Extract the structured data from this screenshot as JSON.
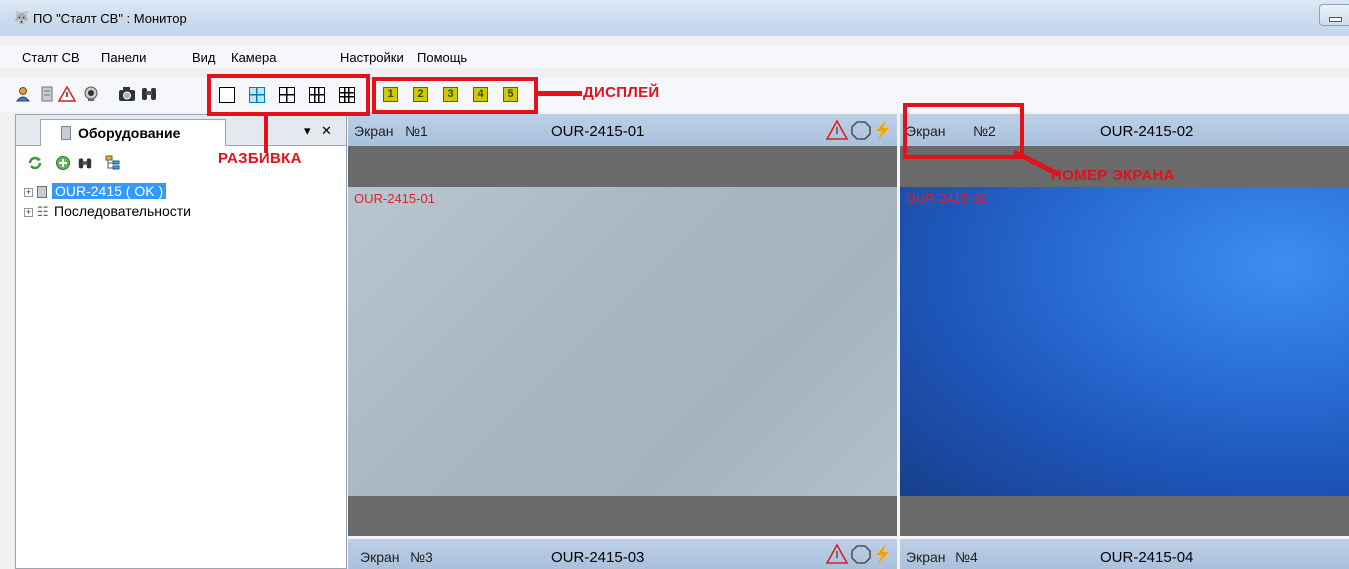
{
  "window": {
    "title": "ПО \"Сталт СВ\" : Монитор"
  },
  "menu": [
    "Сталт СВ",
    "Панели",
    "Вид",
    "Камера",
    "Настройки",
    "Помощь"
  ],
  "toolbar": {
    "display_buttons": [
      "1",
      "2",
      "3",
      "4",
      "5"
    ]
  },
  "annotations": {
    "display": "ДИСПЛЕЙ",
    "split": "РАЗБИВКА",
    "screen_number": "НОМЕР ЭКРАНА"
  },
  "panel": {
    "tab_label": "Оборудование",
    "tree": [
      {
        "label": "OUR-2415 ( OK )",
        "selected": true
      },
      {
        "label": "Последовательности",
        "selected": false
      }
    ]
  },
  "screens": [
    {
      "label": "Экран",
      "number": "№1",
      "camera": "OUR-2415-01",
      "overlay": "OUR-2415-01",
      "status_icons": true
    },
    {
      "label": "Экран",
      "number": "№2",
      "camera": "OUR-2415-02",
      "overlay": "OUR-2415-02",
      "status_icons": false
    },
    {
      "label": "Экран",
      "number": "№3",
      "camera": "OUR-2415-03",
      "status_icons": true
    },
    {
      "label": "Экран",
      "number": "№4",
      "camera": "OUR-2415-04",
      "status_icons": false
    }
  ],
  "colors": {
    "annotation_red": "#e2111a",
    "selection_blue": "#3399ff",
    "header_blue": "#bcd0e6",
    "warning_red": "#d92020",
    "lightning_orange": "#f5a300"
  }
}
